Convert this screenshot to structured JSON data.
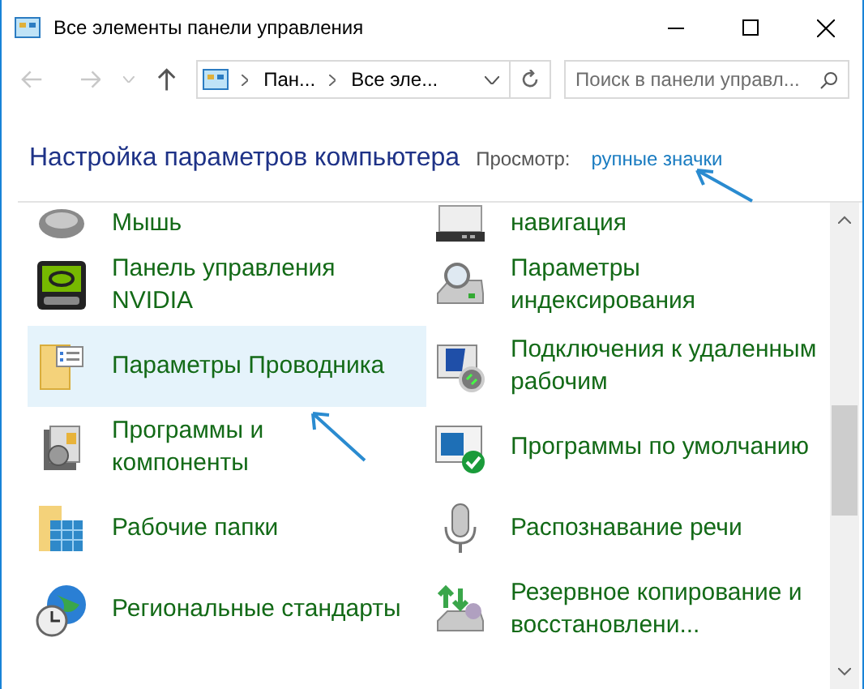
{
  "window": {
    "title": "Все элементы панели управления"
  },
  "address": {
    "crumbs": [
      "Пан...",
      "Все эле..."
    ]
  },
  "search": {
    "placeholder": "Поиск в панели управл..."
  },
  "heading": "Настройка параметров компьютера",
  "view": {
    "label": "Просмотр:",
    "value": "рупные значки"
  },
  "left_items": [
    {
      "label": "Мышь",
      "selected": false
    },
    {
      "label": "Панель управления NVIDIA",
      "selected": false
    },
    {
      "label": "Параметры Проводника",
      "selected": true
    },
    {
      "label": "Программы и компоненты",
      "selected": false
    },
    {
      "label": "Рабочие папки",
      "selected": false
    },
    {
      "label": "Региональные стандарты",
      "selected": false
    }
  ],
  "right_items": [
    {
      "label": "навигация",
      "selected": false
    },
    {
      "label": "Параметры индексирования",
      "selected": false
    },
    {
      "label": "Подключения к удаленным рабочим",
      "selected": false
    },
    {
      "label": "Программы по умолчанию",
      "selected": false
    },
    {
      "label": "Распознавание речи",
      "selected": false
    },
    {
      "label": "Резервное копирование и восстановлени...",
      "selected": false
    }
  ]
}
